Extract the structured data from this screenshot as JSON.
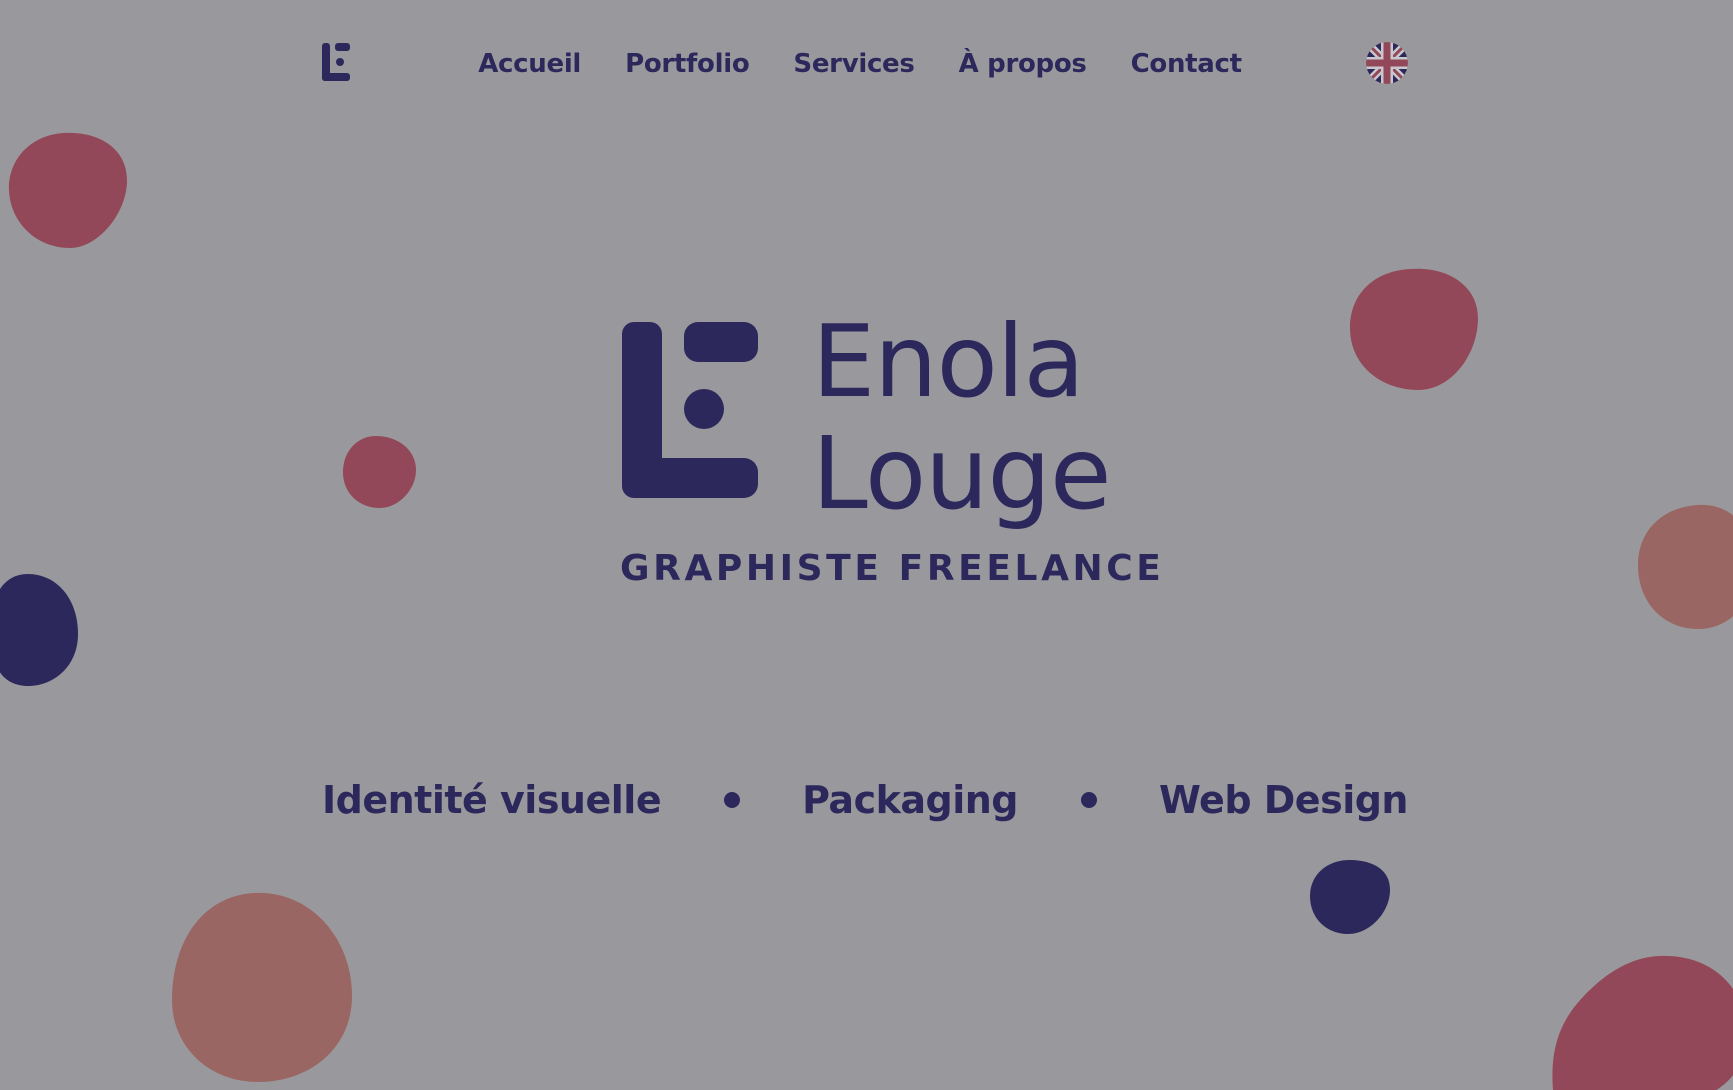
{
  "header": {
    "logo_icon": "enola-louge-monogram-icon",
    "nav": [
      {
        "label": "Accueil"
      },
      {
        "label": "Portfolio"
      },
      {
        "label": "Services"
      },
      {
        "label": "À propos"
      },
      {
        "label": "Contact"
      }
    ],
    "language_icon": "uk-flag-icon"
  },
  "hero": {
    "name_line1": "Enola",
    "name_line2": "Louge",
    "subtitle": "GRAPHISTE FREELANCE"
  },
  "services": [
    {
      "label": "Identité visuelle"
    },
    {
      "label": "Packaging"
    },
    {
      "label": "Web Design"
    }
  ],
  "colors": {
    "background": "#99999d",
    "primary": "#2c285b",
    "blob_red": "#924858",
    "blob_salmon": "#996663"
  }
}
